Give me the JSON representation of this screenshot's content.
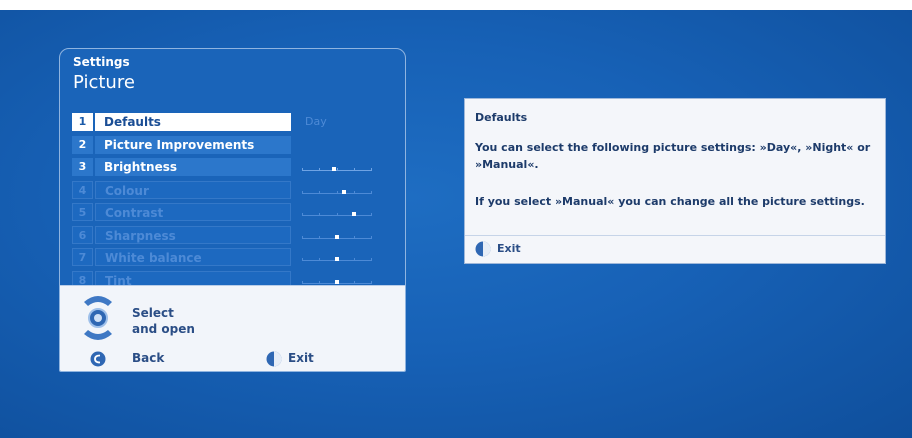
{
  "menu": {
    "breadcrumb": "Settings",
    "title": "Picture",
    "items": [
      {
        "num": "1",
        "label": "Defaults",
        "value": "Day",
        "state": "selected"
      },
      {
        "num": "2",
        "label": "Picture Improvements",
        "state": "normal"
      },
      {
        "num": "3",
        "label": "Brightness",
        "state": "normal",
        "level": 0.45
      },
      {
        "num": "4",
        "label": "Colour",
        "state": "disabled",
        "level": 0.6
      },
      {
        "num": "5",
        "label": "Contrast",
        "state": "disabled",
        "level": 0.75
      },
      {
        "num": "6",
        "label": "Sharpness",
        "state": "disabled",
        "level": 0.5
      },
      {
        "num": "7",
        "label": "White balance",
        "state": "disabled",
        "level": 0.5
      },
      {
        "num": "8",
        "label": "Tint",
        "state": "disabled",
        "level": 0.5
      }
    ],
    "footer": {
      "select_line1": "Select",
      "select_line2": "and open",
      "back_label": "Back",
      "exit_label": "Exit"
    }
  },
  "info": {
    "title": "Defaults",
    "paragraph1": "You can select the following picture settings: »Day«, »Night« or »Manual«.",
    "paragraph2": "If you select »Manual« you can change all the picture settings.",
    "exit_label": "Exit"
  },
  "colors": {
    "background": "#1761b6",
    "panel": "#1a64b9",
    "highlight": "#ffffff",
    "footer_bg": "#f2f5fa",
    "text_dark": "#1d3b6a"
  },
  "icons": [
    "nav-pad-icon",
    "back-button-icon",
    "exit-button-icon"
  ]
}
